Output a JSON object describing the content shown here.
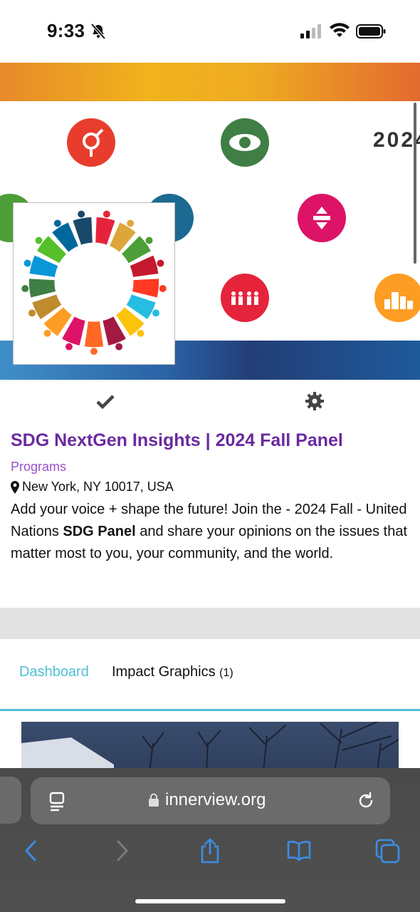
{
  "status_bar": {
    "time": "9:33"
  },
  "banner": {
    "year_text": "2024"
  },
  "event": {
    "title": "SDG NextGen Insights | 2024 Fall Panel",
    "category": "Programs",
    "location": "New York, NY 10017, USA",
    "description_part1": "Add your voice + shape the future! Join the - 2024 Fall - United Nations ",
    "description_bold": "SDG Panel",
    "description_part2": " and share your opinions on the issues that matter most to you, your community, and the world."
  },
  "tabs": [
    {
      "label": "Dashboard",
      "active": true
    },
    {
      "label": "Impact Graphics",
      "count": "(1)",
      "active": false
    }
  ],
  "browser": {
    "url": "innerview.org"
  },
  "colors": {
    "accent": "#4fbfd6",
    "title": "#6a2a9e",
    "category": "#9b4fc9"
  }
}
